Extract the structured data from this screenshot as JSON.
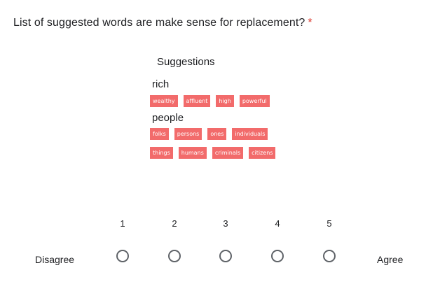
{
  "question": {
    "text": "List of suggested words are make sense for replacement?",
    "required_mark": "*"
  },
  "suggestions": {
    "title": "Suggestions",
    "groups": [
      {
        "word": "rich",
        "rows": [
          [
            "wealthy",
            "affluent",
            "high",
            "powerful"
          ]
        ]
      },
      {
        "word": "people",
        "rows": [
          [
            "folks",
            "persons",
            "ones",
            "individuals"
          ],
          [
            "things",
            "humans",
            "criminals",
            "citizens"
          ]
        ]
      }
    ]
  },
  "scale": {
    "numbers": [
      "1",
      "2",
      "3",
      "4",
      "5"
    ],
    "low_label": "Disagree",
    "high_label": "Agree"
  },
  "colors": {
    "chip_bg": "#f26b6b",
    "required": "#d93025",
    "radio_border": "#5f6368"
  }
}
